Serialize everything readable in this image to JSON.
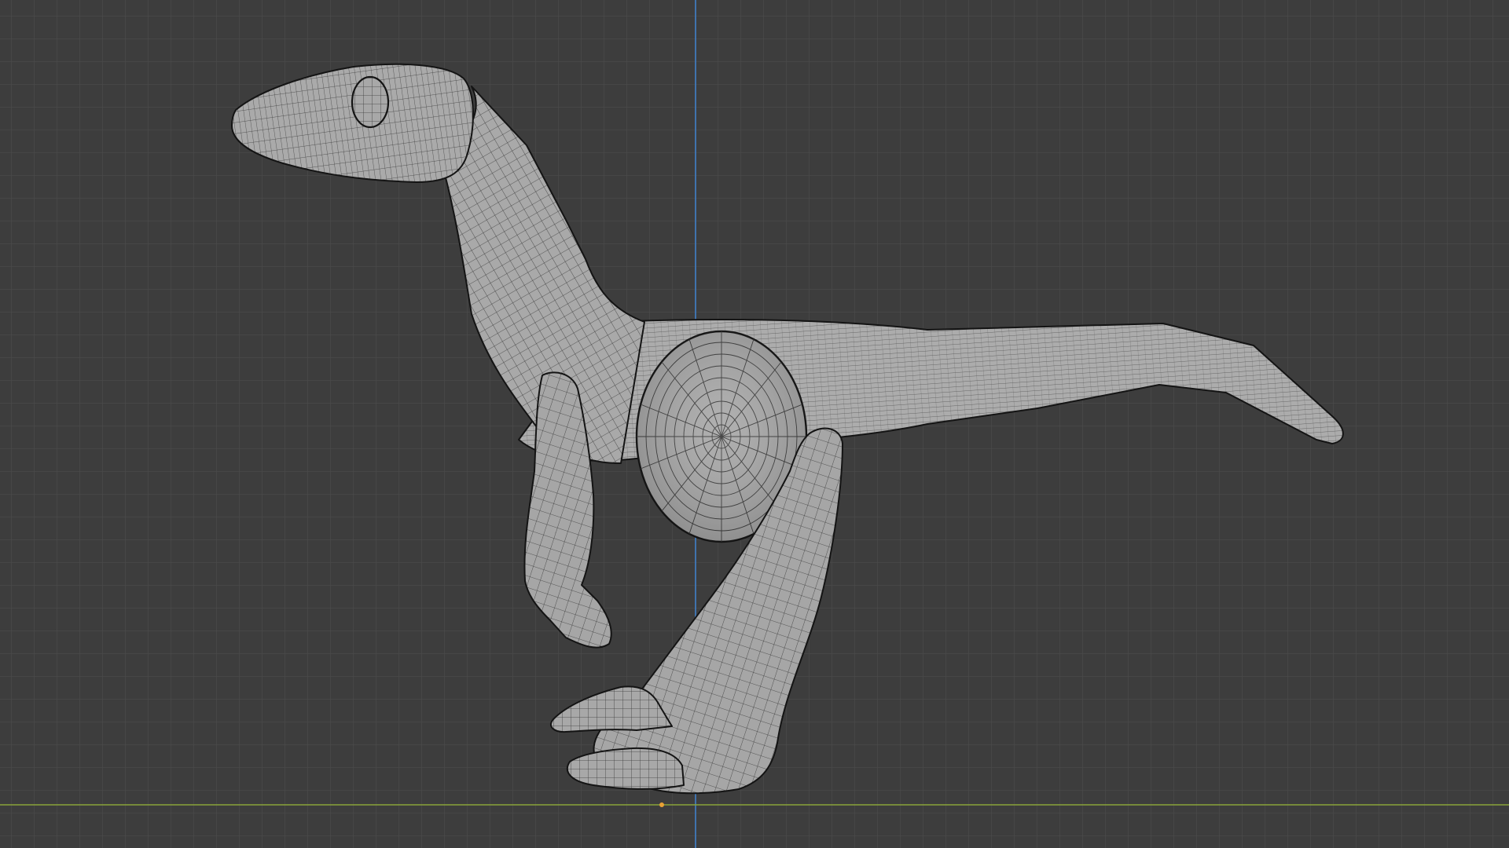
{
  "viewport": {
    "background_color": "#3d3d3d",
    "grid_line_color": "#4b4b4b",
    "y_axis_color": "#3f7fc8",
    "x_axis_color": "#8aa33a",
    "origin_marker_color": "#e8a135"
  },
  "model": {
    "name": "raptor-wireframe-mesh",
    "fill_color": "#a9a9a9",
    "wire_color": "#2b2b2b",
    "outline_color": "#141414",
    "view_mode": "wireframe-over-solid"
  }
}
